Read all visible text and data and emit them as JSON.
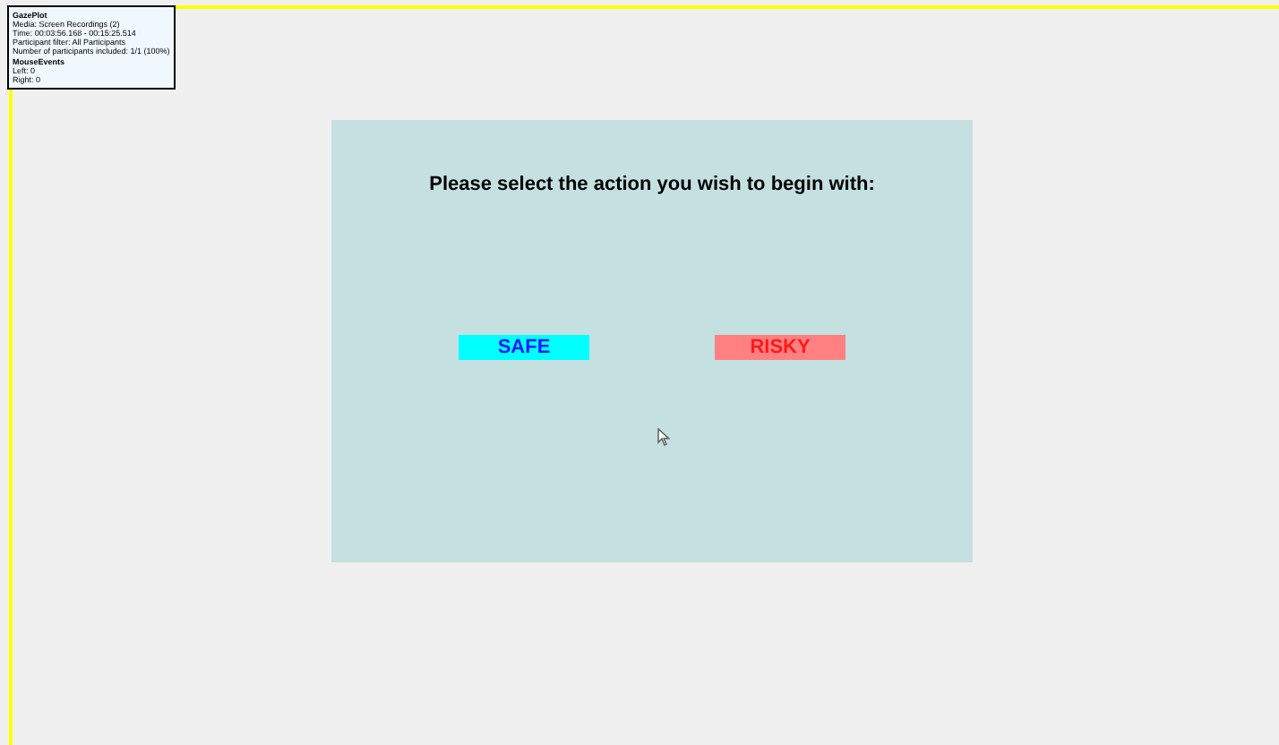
{
  "legend": {
    "title": "GazePlot",
    "lines": [
      "Media: Screen Recordings (2)",
      "Time: 00:03:56.168 - 00:15:25.514",
      "Participant filter: All Participants",
      "Number of participants included: 1/1 (100%)"
    ],
    "section": "MouseEvents",
    "counts": [
      "Left: 0",
      "Right: 0"
    ]
  },
  "stimulus": {
    "prompt": "Please select the action you wish to begin with:",
    "options": [
      {
        "label": "SAFE",
        "kind": "safe"
      },
      {
        "label": "RISKY",
        "kind": "risky"
      }
    ]
  }
}
